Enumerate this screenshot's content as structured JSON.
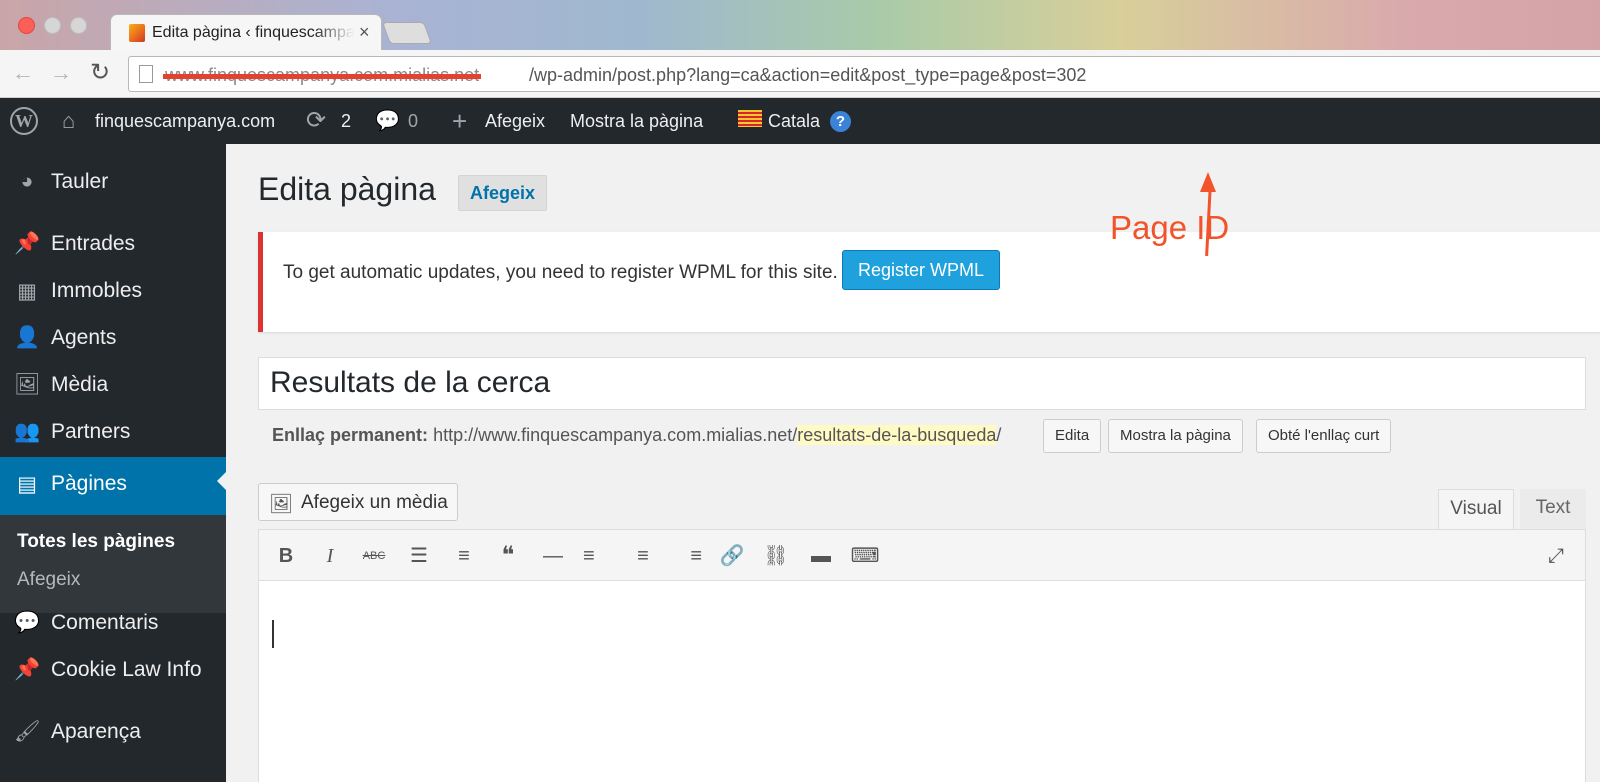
{
  "browser": {
    "tab_title": "Edita pàgina ‹ finquescampanya",
    "tab_close": "×",
    "url_host": "www.finquescampanya.com.mialias.net",
    "url_path": "/wp-admin/post.php?lang=ca&action=edit&post_type=page&post=302",
    "icons": {
      "back": "←",
      "forward": "→",
      "reload": "↻"
    }
  },
  "adminbar": {
    "logo": "W",
    "site_name": "finquescampanya.com",
    "updates_count": "2",
    "comments_count": "0",
    "new_label": "Afegeix",
    "view_label": "Mostra la pàgina",
    "language": "Catala",
    "help": "?",
    "icons": {
      "home": "⌂",
      "updates": "⟳",
      "comments": "💬",
      "new": "+"
    }
  },
  "sidebar": {
    "items": [
      {
        "label": "Tauler",
        "icon": "◕"
      },
      {
        "label": "Entrades",
        "icon": "📌"
      },
      {
        "label": "Immobles",
        "icon": "▦"
      },
      {
        "label": "Agents",
        "icon": "👤"
      },
      {
        "label": "Mèdia",
        "icon": "🖼"
      },
      {
        "label": "Partners",
        "icon": "👥"
      },
      {
        "label": "Pàgines",
        "icon": "▤"
      },
      {
        "label": "Comentaris",
        "icon": "💬"
      },
      {
        "label": "Cookie Law Info",
        "icon": "📌"
      },
      {
        "label": "Aparença",
        "icon": "🖌"
      }
    ],
    "submenu": [
      {
        "label": "Totes les pàgines"
      },
      {
        "label": "Afegeix"
      }
    ]
  },
  "main": {
    "heading": "Edita pàgina",
    "add_new": "Afegeix",
    "notice_text": "To get automatic updates, you need to register WPML for this site.",
    "register_button": "Register WPML",
    "annotation": "Page ID",
    "post_title": "Resultats de la cerca",
    "permalink_label": "Enllaç permanent:",
    "permalink_base": "http://www.finquescampanya.com.mialias.net/",
    "permalink_slug": "resultats-de-la-busqueda",
    "permalink_trail": "/",
    "buttons": {
      "edit": "Edita",
      "view": "Mostra la pàgina",
      "shortlink": "Obté l'enllaç curt"
    },
    "media_button": "Afegeix un mèdia",
    "tab_visual": "Visual",
    "tab_text": "Text",
    "toolbar": {
      "bold": "B",
      "italic": "I",
      "strike": "ABC",
      "ul": "☰",
      "ol": "≡",
      "quote": "❝",
      "hr": "—",
      "align_left": "≡",
      "align_center": "≡",
      "align_right": "≡",
      "link": "🔗",
      "unlink": "⛓",
      "more": "▬",
      "kitchen": "⌨",
      "fullscreen": "⤢"
    }
  },
  "colors": {
    "admin_bg": "#23282d",
    "current_menu": "#0073aa",
    "notice_border": "#dc3232",
    "register_btn": "#1ea1dc",
    "annotation": "#f2532b"
  }
}
